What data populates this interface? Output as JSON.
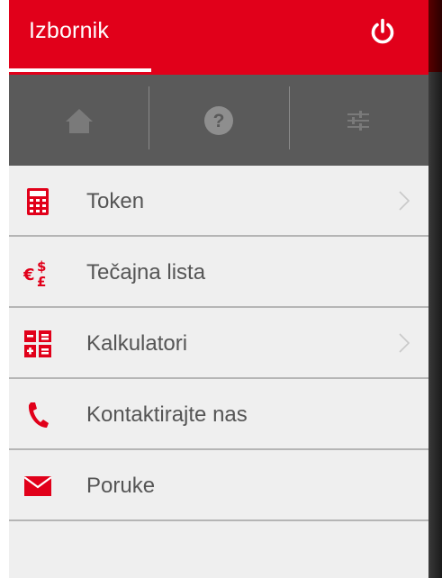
{
  "header": {
    "title": "Izbornik",
    "brand_color": "#e1001a",
    "power_icon": "power-icon"
  },
  "tabs": [
    {
      "icon": "home-icon",
      "active": true
    },
    {
      "icon": "help-icon",
      "active": false
    },
    {
      "icon": "settings-sliders-icon",
      "active": false
    }
  ],
  "menu": {
    "items": [
      {
        "label": "Token",
        "icon": "calculator-icon",
        "has_chevron": true
      },
      {
        "label": "Tečajna lista",
        "icon": "currency-icon",
        "has_chevron": false
      },
      {
        "label": "Kalkulatori",
        "icon": "calculators-icon",
        "has_chevron": true
      },
      {
        "label": "Kontaktirajte nas",
        "icon": "phone-icon",
        "has_chevron": false
      },
      {
        "label": "Poruke",
        "icon": "envelope-icon",
        "has_chevron": false
      }
    ]
  }
}
